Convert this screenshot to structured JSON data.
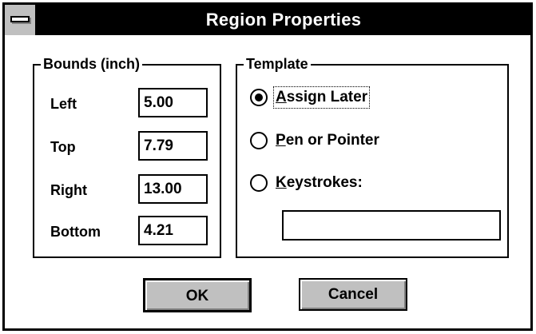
{
  "window": {
    "title": "Region Properties"
  },
  "bounds": {
    "group_title": "Bounds (inch)",
    "fields": [
      {
        "label": "Left",
        "value": "5.00"
      },
      {
        "label": "Top",
        "value": "7.79"
      },
      {
        "label": "Right",
        "value": "13.00"
      },
      {
        "label": "Bottom",
        "value": "4.21"
      }
    ]
  },
  "template": {
    "group_title": "Template",
    "options": [
      {
        "mnemonic": "A",
        "rest": "ssign Later",
        "checked": true
      },
      {
        "mnemonic": "P",
        "rest": "en or Pointer",
        "checked": false
      },
      {
        "mnemonic": "K",
        "rest": "eystrokes:",
        "checked": false
      }
    ],
    "keystrokes_value": ""
  },
  "buttons": {
    "ok_label": "OK",
    "cancel_label": "Cancel"
  },
  "icons": {
    "system_menu": "system-menu-icon",
    "radio": "radio-button-icon"
  },
  "colors": {
    "titlebar": "#000000",
    "button_face": "#c0c0c0",
    "background": "#ffffff"
  }
}
